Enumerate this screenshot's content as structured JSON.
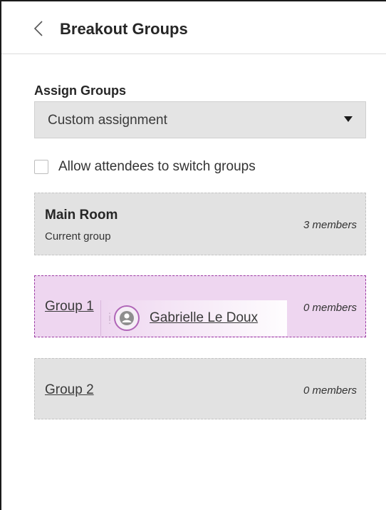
{
  "header": {
    "title": "Breakout Groups"
  },
  "assign": {
    "label": "Assign Groups",
    "selected": "Custom assignment"
  },
  "options": {
    "allow_switch_label": "Allow attendees to switch groups",
    "allow_switch_checked": false
  },
  "main_room": {
    "name": "Main Room",
    "subtitle": "Current group",
    "members": "3 members"
  },
  "groups": [
    {
      "name": "Group 1",
      "members": "0 members"
    },
    {
      "name": "Group 2",
      "members": "0 members"
    }
  ],
  "dragged_attendee": {
    "name": "Gabrielle Le Doux",
    "icon": "user-avatar-icon"
  },
  "colors": {
    "highlight_bg": "#eed6f0",
    "highlight_border": "#9b3aa3",
    "card_bg": "#e2e2e2"
  }
}
